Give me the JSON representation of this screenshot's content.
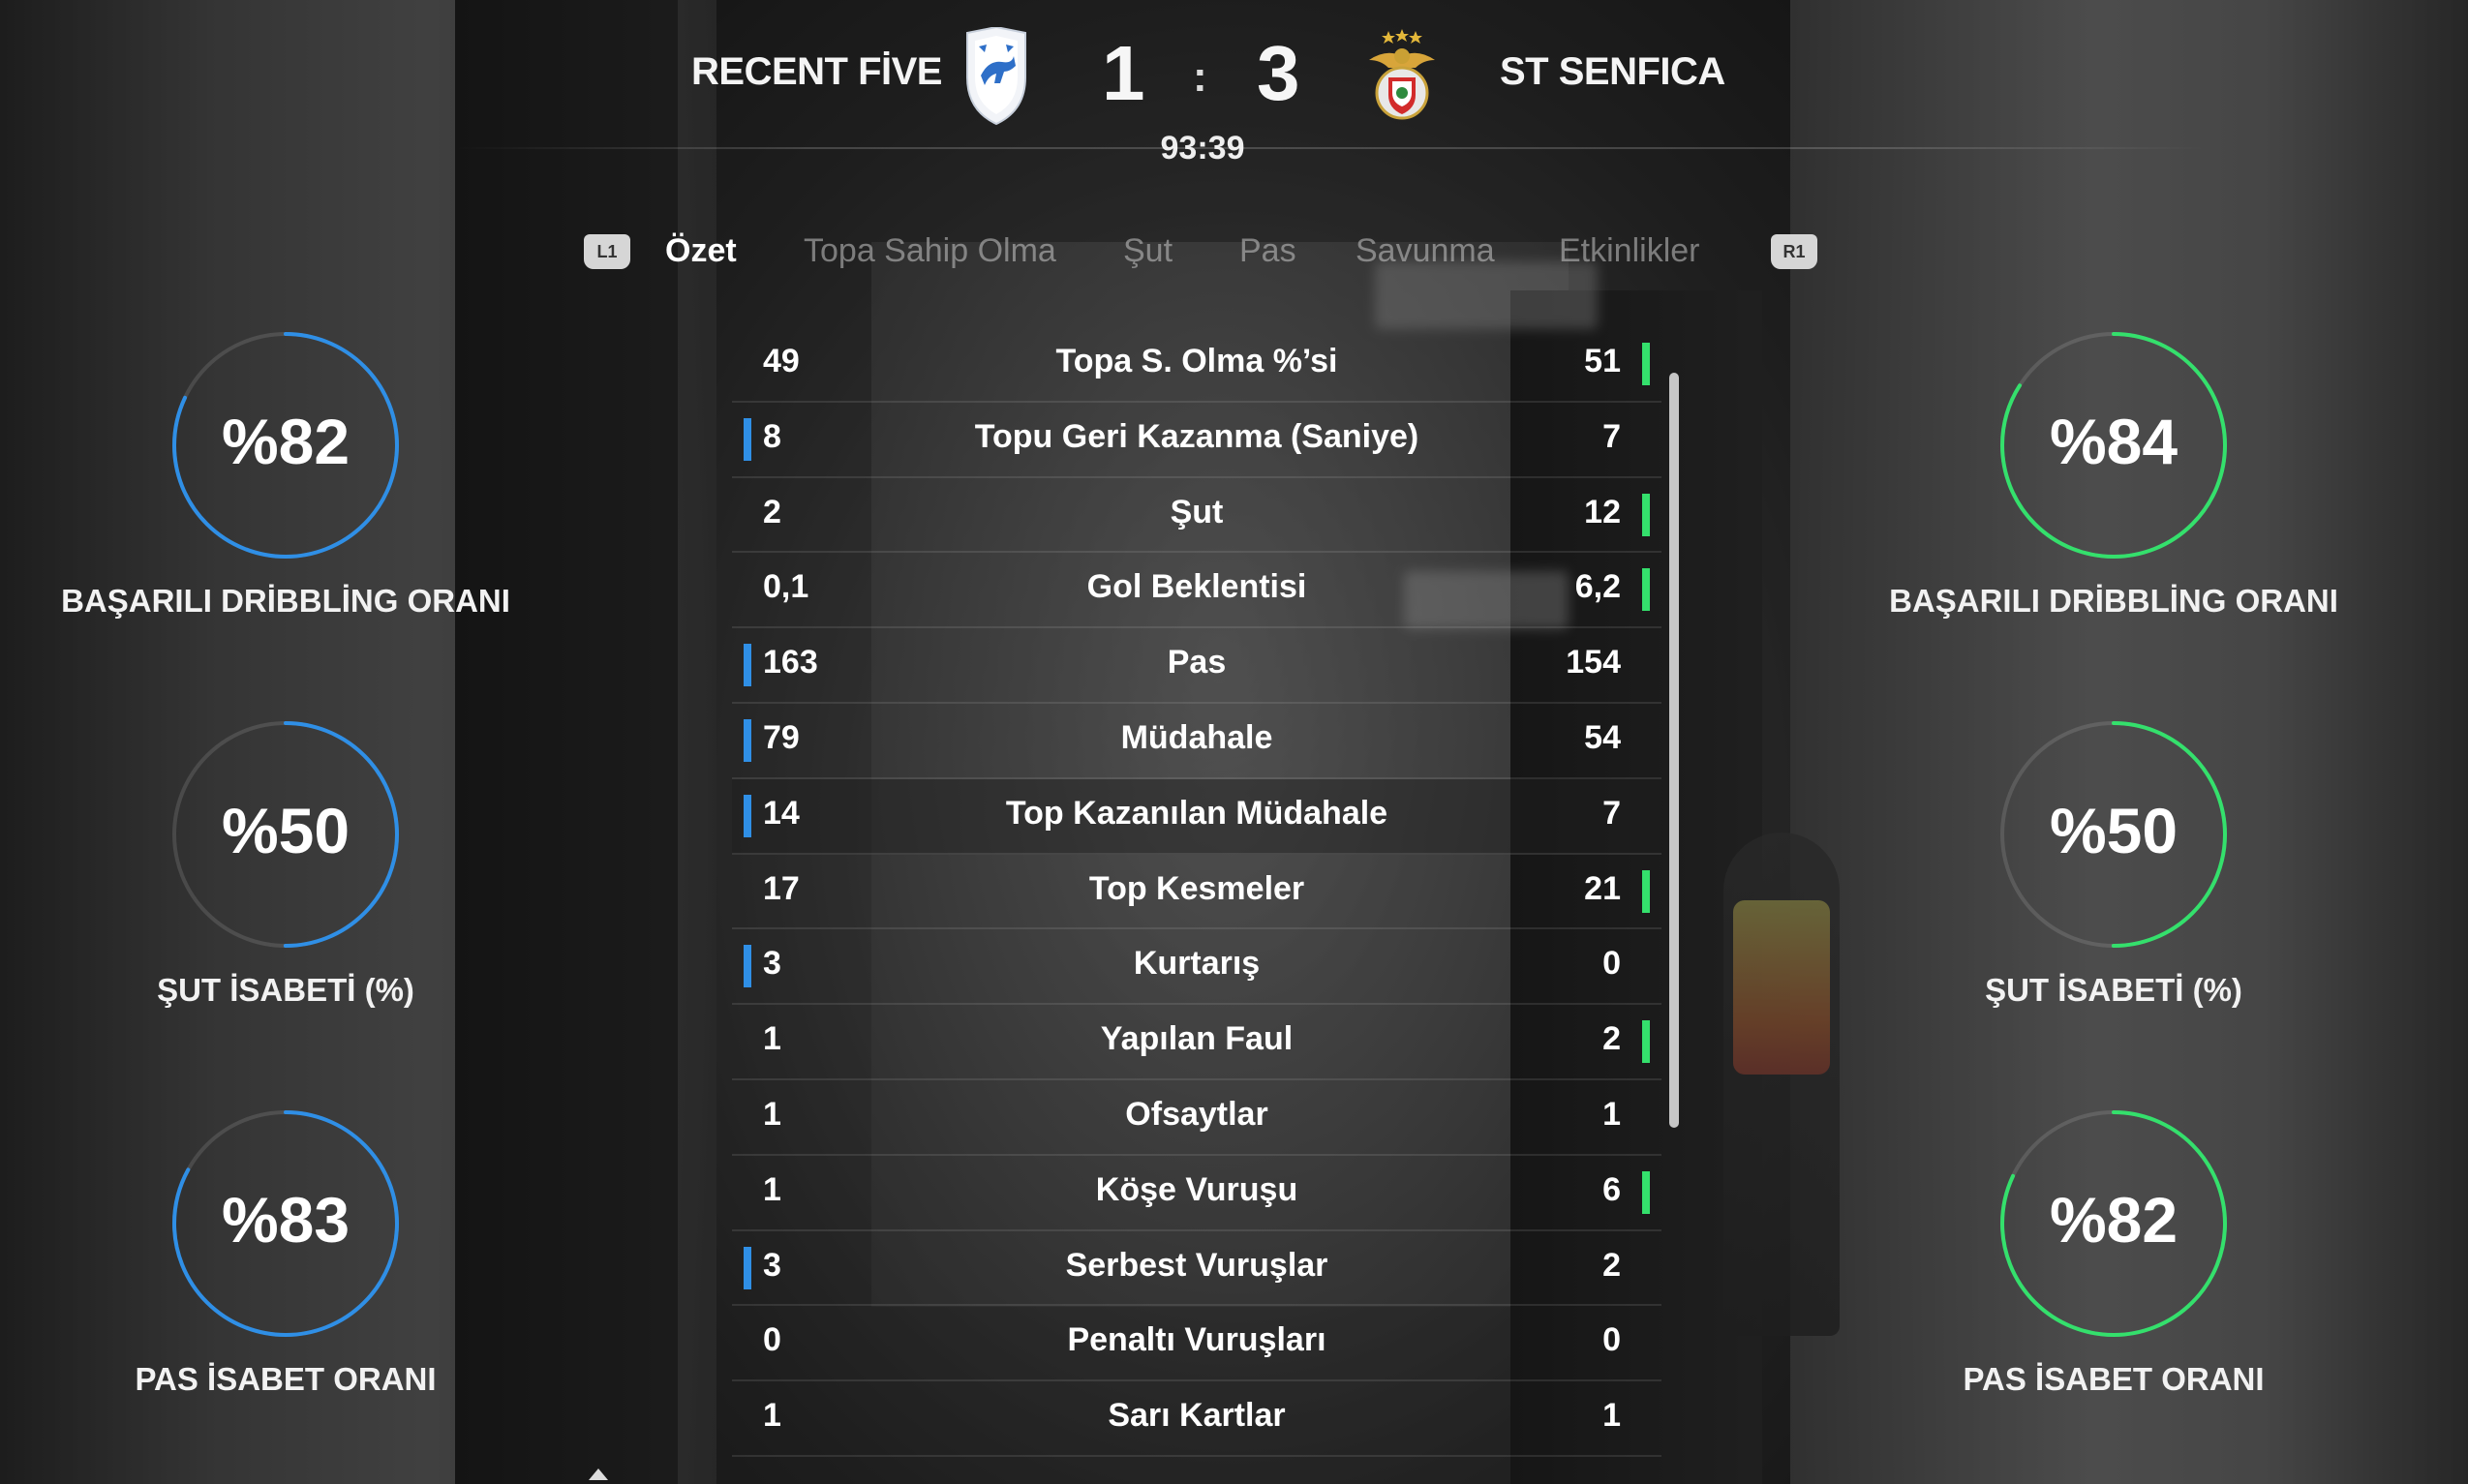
{
  "header": {
    "home_team": "RECENT FİVE",
    "away_team": "ST SENFICA",
    "home_score": "1",
    "away_score": "3",
    "separator": ":",
    "clock": "93:39",
    "home_color": "#2f8fe6",
    "away_color": "#34e06c"
  },
  "tabs": {
    "left_bumper": "L1",
    "right_bumper": "R1",
    "items": [
      {
        "label": "Özet",
        "active": true
      },
      {
        "label": "Topa Sahip Olma",
        "active": false
      },
      {
        "label": "Şut",
        "active": false
      },
      {
        "label": "Pas",
        "active": false
      },
      {
        "label": "Savunma",
        "active": false
      },
      {
        "label": "Etkinlikler",
        "active": false
      }
    ]
  },
  "stats": [
    {
      "label": "Topa S. Olma %’si",
      "home": "49",
      "away": "51",
      "leader": "away"
    },
    {
      "label": "Topu Geri Kazanma (Saniye)",
      "home": "8",
      "away": "7",
      "leader": "home"
    },
    {
      "label": "Şut",
      "home": "2",
      "away": "12",
      "leader": "away"
    },
    {
      "label": "Gol Beklentisi",
      "home": "0,1",
      "away": "6,2",
      "leader": "away"
    },
    {
      "label": "Pas",
      "home": "163",
      "away": "154",
      "leader": "home"
    },
    {
      "label": "Müdahale",
      "home": "79",
      "away": "54",
      "leader": "home"
    },
    {
      "label": "Top Kazanılan Müdahale",
      "home": "14",
      "away": "7",
      "leader": "home"
    },
    {
      "label": "Top Kesmeler",
      "home": "17",
      "away": "21",
      "leader": "away"
    },
    {
      "label": "Kurtarış",
      "home": "3",
      "away": "0",
      "leader": "home"
    },
    {
      "label": "Yapılan Faul",
      "home": "1",
      "away": "2",
      "leader": "away"
    },
    {
      "label": "Ofsaytlar",
      "home": "1",
      "away": "1",
      "leader": "none"
    },
    {
      "label": "Köşe Vuruşu",
      "home": "1",
      "away": "6",
      "leader": "away"
    },
    {
      "label": "Serbest Vuruşlar",
      "home": "3",
      "away": "2",
      "leader": "home"
    },
    {
      "label": "Penaltı Vuruşları",
      "home": "0",
      "away": "0",
      "leader": "none"
    },
    {
      "label": "Sarı Kartlar",
      "home": "1",
      "away": "1",
      "leader": "none"
    }
  ],
  "gauges": {
    "home": [
      {
        "value": "%82",
        "label": "BAŞARILI DRİBBLİNG ORANI",
        "percent": 82
      },
      {
        "value": "%50",
        "label": "ŞUT İSABETİ (%)",
        "percent": 50
      },
      {
        "value": "%83",
        "label": "PAS İSABET ORANI",
        "percent": 83
      }
    ],
    "away": [
      {
        "value": "%84",
        "label": "BAŞARILI DRİBBLİNG ORANI",
        "percent": 84
      },
      {
        "value": "%50",
        "label": "ŞUT İSABETİ (%)",
        "percent": 50
      },
      {
        "value": "%82",
        "label": "PAS İSABET ORANI",
        "percent": 82
      }
    ]
  }
}
